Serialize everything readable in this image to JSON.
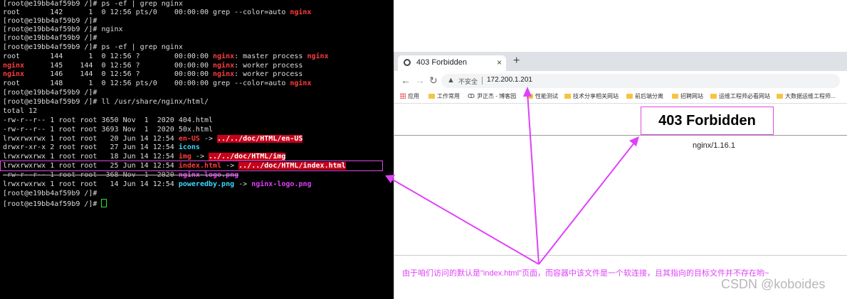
{
  "terminal": {
    "lines": [
      {
        "t": "[root@e19bb4af59b9 /]# ps -ef | grep nginx"
      },
      {
        "a": "root       142      1  0 12:56 pts/0    00:00:00 grep --color=auto ",
        "b": "nginx"
      },
      {
        "t": "[root@e19bb4af59b9 /]#"
      },
      {
        "t": "[root@e19bb4af59b9 /]# nginx"
      },
      {
        "t": "[root@e19bb4af59b9 /]#"
      },
      {
        "t": "[root@e19bb4af59b9 /]# ps -ef | grep nginx"
      },
      {
        "a": "root       144      1  0 12:56 ?        00:00:00 ",
        "b": "nginx",
        "c": ": master process ",
        "d": "nginx"
      },
      {
        "u": "nginx",
        "a": "      145    144  0 12:56 ?        00:00:00 ",
        "b": "nginx",
        "c": ": worker process"
      },
      {
        "u": "nginx",
        "a": "      146    144  0 12:56 ?        00:00:00 ",
        "b": "nginx",
        "c": ": worker process"
      },
      {
        "a": "root       148      1  0 12:56 pts/0    00:00:00 grep --color=auto ",
        "b": "nginx"
      },
      {
        "t": "[root@e19bb4af59b9 /]#"
      },
      {
        "t": "[root@e19bb4af59b9 /]# ll /usr/share/nginx/html/"
      },
      {
        "t": "total 12"
      },
      {
        "t": "-rw-r--r-- 1 root root 3650 Nov  1  2020 404.html"
      },
      {
        "t": "-rw-r--r-- 1 root root 3693 Nov  1  2020 50x.html"
      },
      {
        "a": "lrwxrwxrwx 1 root root   20 Jun 14 12:54 ",
        "b": "en-US",
        "c": " -> ",
        "d": "../../doc/HTML/en-US"
      },
      {
        "a": "drwxr-xr-x 2 root root   27 Jun 14 12:54 ",
        "b": "icons"
      },
      {
        "a": "lrwxrwxrwx 1 root root   18 Jun 14 12:54 ",
        "b": "img",
        "c": " -> ",
        "d": "../../doc/HTML/img"
      },
      {
        "a": "lrwxrwxrwx 1 root root   25 Jun 14 12:54 ",
        "b": "index.html",
        "c": " -> ",
        "d": "../../doc/HTML/index.html"
      },
      {
        "a": "-rw-r--r-- 1 root root  368 Nov  1  2020 ",
        "b": "nginx-logo.png"
      },
      {
        "a": "lrwxrwxrwx 1 root root   14 Jun 14 12:54 ",
        "b": "poweredby.png",
        "c": " -> ",
        "d": "nginx-logo.png"
      },
      {
        "t": "[root@e19bb4af59b9 /]#"
      },
      {
        "t": "[root@e19bb4af59b9 /]# "
      }
    ]
  },
  "browser": {
    "tab_title": "403 Forbidden",
    "tab_close": "×",
    "new_tab": "+",
    "nav_back": "←",
    "nav_forward": "→",
    "nav_reload": "↻",
    "warning_icon": "▲",
    "insecure_label": "不安全",
    "url": "172.200.1.201",
    "bookmarks": [
      "应用",
      "工作常用",
      "尹正杰 - 博客园",
      "性能测试",
      "技术分享相关网站",
      "前后端分离",
      "招聘网站",
      "运维工程师必看网站",
      "大数据运维工程师..."
    ],
    "page_heading": "403 Forbidden",
    "server_version": "nginx/1.16.1"
  },
  "annotation": {
    "note": "由于咱们访问的默认是\"index.html\"页面，而容器中该文件是一个软连接，且其指向的目标文件并不存在哟~",
    "watermark": "CSDN @koboides",
    "color": "#e040fb"
  }
}
